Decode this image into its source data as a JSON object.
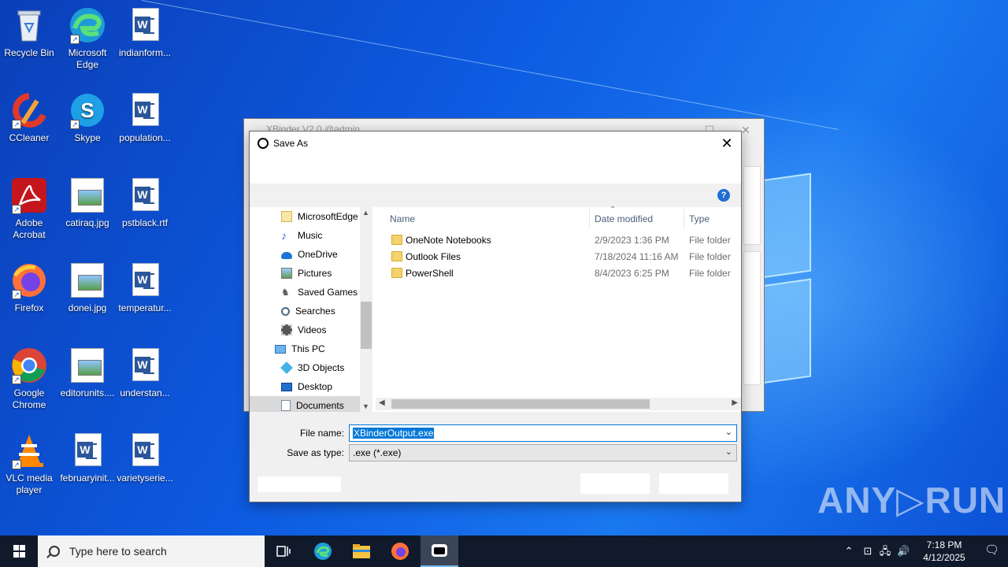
{
  "desktop": {
    "icons": [
      {
        "label": "Recycle Bin",
        "icon": "recycle-bin-icon"
      },
      {
        "label": "Microsoft Edge",
        "icon": "edge-icon"
      },
      {
        "label": "indianform...",
        "icon": "word-doc-icon"
      },
      {
        "label": "CCleaner",
        "icon": "ccleaner-icon"
      },
      {
        "label": "Skype",
        "icon": "skype-icon"
      },
      {
        "label": "population...",
        "icon": "word-doc-icon"
      },
      {
        "label": "Adobe Acrobat",
        "icon": "acrobat-icon"
      },
      {
        "label": "catiraq.jpg",
        "icon": "image-file-icon"
      },
      {
        "label": "pstblack.rtf",
        "icon": "word-doc-icon"
      },
      {
        "label": "Firefox",
        "icon": "firefox-icon"
      },
      {
        "label": "donei.jpg",
        "icon": "image-file-icon"
      },
      {
        "label": "temperatur...",
        "icon": "word-doc-icon"
      },
      {
        "label": "Google Chrome",
        "icon": "chrome-icon"
      },
      {
        "label": "editorunits....",
        "icon": "image-file-icon"
      },
      {
        "label": "understan...",
        "icon": "word-doc-icon"
      },
      {
        "label": "VLC media player",
        "icon": "vlc-icon"
      },
      {
        "label": "februaryinit...",
        "icon": "word-doc-icon"
      },
      {
        "label": "varietyserie...",
        "icon": "word-doc-icon"
      }
    ]
  },
  "bg_window": {
    "title": "XBinder V2.0 @admin"
  },
  "dialog": {
    "title": "Save As",
    "close_glyph": "✕",
    "help_glyph": "?",
    "nav_items": [
      {
        "label": "MicrosoftEdge",
        "icon": "folder-icon"
      },
      {
        "label": "Music",
        "icon": "music-icon"
      },
      {
        "label": "OneDrive",
        "icon": "onedrive-icon"
      },
      {
        "label": "Pictures",
        "icon": "pictures-icon"
      },
      {
        "label": "Saved Games",
        "icon": "saved-games-icon"
      },
      {
        "label": "Searches",
        "icon": "searches-icon"
      },
      {
        "label": "Videos",
        "icon": "videos-icon"
      },
      {
        "label": "This PC",
        "icon": "this-pc-icon"
      },
      {
        "label": "3D Objects",
        "icon": "3d-objects-icon"
      },
      {
        "label": "Desktop",
        "icon": "desktop-icon"
      },
      {
        "label": "Documents",
        "icon": "documents-icon"
      }
    ],
    "columns": {
      "name": "Name",
      "date": "Date modified",
      "type": "Type"
    },
    "files": [
      {
        "name": "OneNote Notebooks",
        "date": "2/9/2023 1:36 PM",
        "type": "File folder"
      },
      {
        "name": "Outlook Files",
        "date": "7/18/2024 11:16 AM",
        "type": "File folder"
      },
      {
        "name": "PowerShell",
        "date": "8/4/2023 6:25 PM",
        "type": "File folder"
      }
    ],
    "file_name_label": "File name:",
    "file_name_value": "XBinderOutput.exe",
    "save_type_label": "Save as type:",
    "save_type_value": ".exe (*.exe)"
  },
  "taskbar": {
    "search_placeholder": "Type here to search",
    "time": "7:18 PM",
    "date": "4/12/2025"
  },
  "watermark": "ANY▷RUN",
  "colors": {
    "accent": "#0078d7",
    "taskbar": "#101a2b",
    "folder": "#f5d36b"
  }
}
